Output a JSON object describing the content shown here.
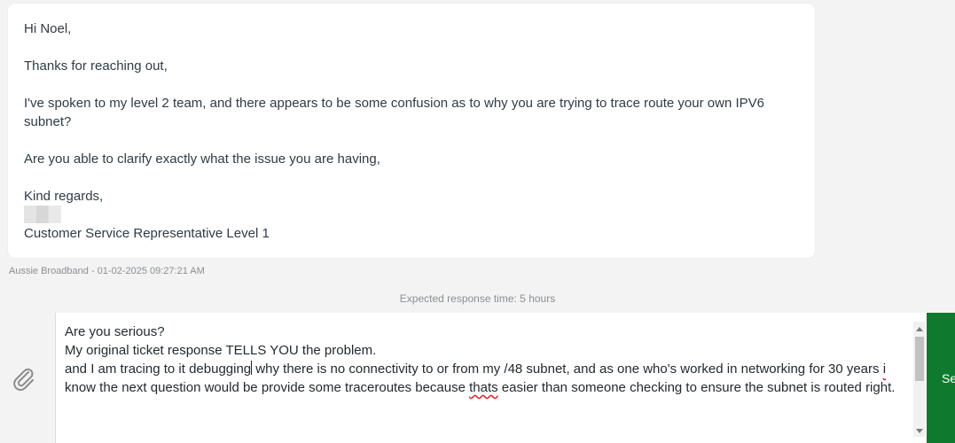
{
  "message": {
    "greeting": "Hi Noel,",
    "line1": "Thanks for reaching out,",
    "line2": "I've spoken to my level 2 team, and there appears to be some confusion as to why you are trying to trace route your own IPV6 subnet?",
    "line3": "Are you able to clarify exactly what the issue you are having,",
    "signoff": "Kind regards,",
    "signature_title": "Customer Service Representative Level 1"
  },
  "meta": {
    "sender_time": "Aussie Broadband - 01-02-2025 09:27:21 AM"
  },
  "expected_response": "Expected response time: 5 hours",
  "composer": {
    "line1": "Are you serious?",
    "line2": "My original ticket response TELLS YOU the problem.",
    "line3_a": "and I am tracing to it debugging",
    "line3_b": " why there is no connectivity to or from my /48 subnet, and as one who's worked in networking for 30 years ",
    "line3_i": "i",
    "line3_c": " know the next question would be provide some traceroutes because ",
    "line3_thats": "thats",
    "line3_d": " easier than someone checking to ensure the subnet is routed right."
  },
  "send_button": {
    "label": "Send"
  },
  "icons": {
    "attach": "paperclip-icon"
  }
}
